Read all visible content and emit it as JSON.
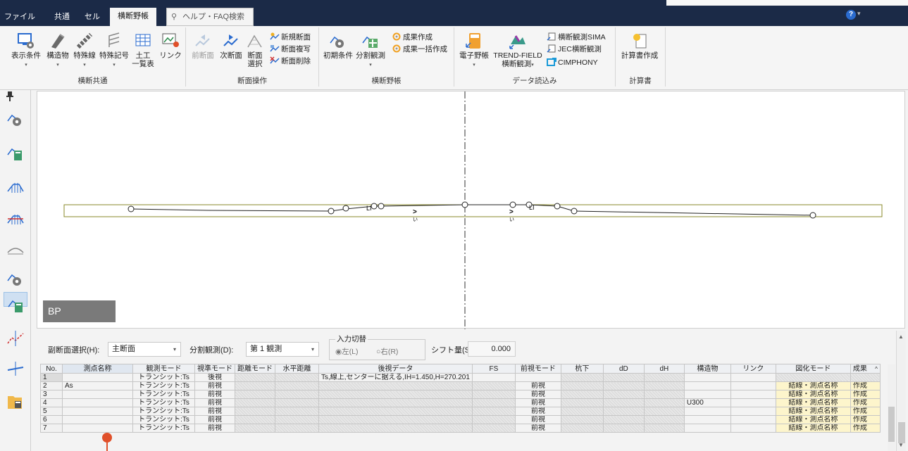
{
  "menu_tabs": [
    {
      "label": "ファイル"
    },
    {
      "label": "共通"
    },
    {
      "label": "セル"
    },
    {
      "label": "横断野帳"
    }
  ],
  "help_search": "ヘルプ・FAQ検索",
  "help_icon": "?",
  "ribbon": {
    "groups": {
      "common": "横断共通",
      "section_ops": "断面操作",
      "yacho": "横断野帳",
      "data_import": "データ読込み",
      "report": "計算書"
    },
    "buttons": {
      "display": "表示条件",
      "structure": "構造物",
      "special_line": "特殊線",
      "special_sym": "特殊記号",
      "earthwork1": "土工",
      "earthwork2": "一覧表",
      "link": "リンク",
      "prev": "前断面",
      "next": "次断面",
      "select1": "断面",
      "select2": "選択",
      "new_section": "新規断面",
      "copy_section": "断面複写",
      "delete_section": "断面削除",
      "init": "初期条件",
      "split": "分割観測",
      "result": "成果作成",
      "batch_result": "成果一括作成",
      "e_yacho": "電子野帳",
      "trend1": "TREND-FIELD",
      "trend2": "横断観測",
      "sima": "横断観測SIMA",
      "jec": "JEC横断観測",
      "cimphony": "CIMPHONY",
      "report": "計算書作成"
    }
  },
  "canvas": {
    "bp_label": "BP",
    "station_marks": [
      "い",
      "い",
      "LI",
      "LI"
    ]
  },
  "controls": {
    "sub_section_label": "副断面選択(H):",
    "sub_section_value": "主断面",
    "split_label": "分割観測(D):",
    "split_value": "第 1 観測",
    "input_switch_label": "入力切替",
    "left_label": "左(L)",
    "right_label": "右(R)",
    "shift_label": "シフト量(S)",
    "shift_value": "0.000"
  },
  "table": {
    "headers": [
      "No.",
      "測点名称",
      "観測モード",
      "視準モード",
      "距離モード",
      "水平距離",
      "後視データ",
      "FS",
      "前視モード",
      "杭下",
      "dD",
      "dH",
      "構造物",
      "リンク",
      "図化モード",
      "成果"
    ],
    "rows": [
      {
        "no": "1",
        "name": "",
        "mode": "トランシット:Ts",
        "sight": "後視",
        "bs": "Ts,線上,センターに据える,IH=1.450,H=270.201",
        "fs_mode": "",
        "struct": "",
        "fig": "",
        "res": ""
      },
      {
        "no": "2",
        "name": "As",
        "mode": "トランシット:Ts",
        "sight": "前視",
        "bs": "",
        "fs_mode": "前視",
        "struct": "",
        "fig": "結線・測点名称",
        "res": "作成"
      },
      {
        "no": "3",
        "name": "",
        "mode": "トランシット:Ts",
        "sight": "前視",
        "bs": "",
        "fs_mode": "前視",
        "struct": "",
        "fig": "結線・測点名称",
        "res": "作成"
      },
      {
        "no": "4",
        "name": "",
        "mode": "トランシット:Ts",
        "sight": "前視",
        "bs": "",
        "fs_mode": "前視",
        "struct": "U300",
        "fig": "結線・測点名称",
        "res": "作成"
      },
      {
        "no": "5",
        "name": "",
        "mode": "トランシット:Ts",
        "sight": "前視",
        "bs": "",
        "fs_mode": "前視",
        "struct": "",
        "fig": "結線・測点名称",
        "res": "作成"
      },
      {
        "no": "6",
        "name": "",
        "mode": "トランシット:Ts",
        "sight": "前視",
        "bs": "",
        "fs_mode": "前視",
        "struct": "",
        "fig": "結線・測点名称",
        "res": "作成"
      },
      {
        "no": "7",
        "name": "",
        "mode": "トランシット:Ts",
        "sight": "前視",
        "bs": "",
        "fs_mode": "前視",
        "struct": "",
        "fig": "結線・測点名称",
        "res": "作成"
      }
    ]
  },
  "colors": {
    "titlebar": "#1b2a47",
    "accent": "#2a6bcf",
    "highlight_cell": "#fdf5cc",
    "profile_box": "#8a8a2a"
  }
}
